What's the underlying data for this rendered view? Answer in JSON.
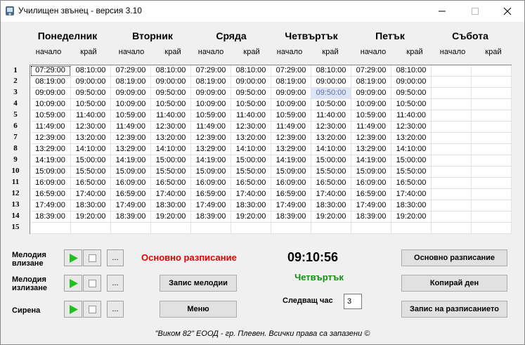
{
  "window": {
    "title": "Училищен звънец - версия 3.10"
  },
  "days": [
    "Понеделник",
    "Вторник",
    "Сряда",
    "Четвъртък",
    "Петък",
    "Събота"
  ],
  "sub_labels": {
    "start": "начало",
    "end": "край"
  },
  "rows": [
    "1",
    "2",
    "3",
    "4",
    "5",
    "6",
    "7",
    "8",
    "9",
    "10",
    "11",
    "12",
    "13",
    "14",
    "15"
  ],
  "slots": [
    [
      "07:29:00",
      "08:10:00"
    ],
    [
      "08:19:00",
      "09:00:00"
    ],
    [
      "09:09:00",
      "09:50:00"
    ],
    [
      "10:09:00",
      "10:50:00"
    ],
    [
      "10:59:00",
      "11:40:00"
    ],
    [
      "11:49:00",
      "12:30:00"
    ],
    [
      "12:39:00",
      "13:20:00"
    ],
    [
      "13:29:00",
      "14:10:00"
    ],
    [
      "14:19:00",
      "15:00:00"
    ],
    [
      "15:09:00",
      "15:50:00"
    ],
    [
      "16:09:00",
      "16:50:00"
    ],
    [
      "16:59:00",
      "17:40:00"
    ],
    [
      "17:49:00",
      "18:30:00"
    ],
    [
      "18:39:00",
      "19:20:00"
    ]
  ],
  "sound_rows": [
    {
      "label_line1": "Мелодия",
      "label_line2": "влизане"
    },
    {
      "label_line1": "Мелодия",
      "label_line2": "излизане"
    },
    {
      "label_line1": "Сирена",
      "label_line2": ""
    }
  ],
  "dots_label": "...",
  "status": "Основно разписание",
  "clock": "09:10:56",
  "current_day": "Четвъртък",
  "buttons": {
    "save_melody": "Запис мелодии",
    "menu": "Меню",
    "main_schedule": "Основно разписание",
    "copy_day": "Копирай ден",
    "save_schedule": "Запис на разписанието"
  },
  "next_hour": {
    "label": "Следващ час",
    "value": "3"
  },
  "footer": "\"Виком 82\" ЕООД - гр. Плевен. Всички права са запазени ©",
  "colors": {
    "status_red": "#e40000",
    "day_green": "#109010",
    "play_green": "#20c020",
    "selected_cell": "#dce6f7"
  },
  "icons": {
    "app": "bell-app-icon",
    "play": "play-icon",
    "stop": "stop-icon"
  }
}
